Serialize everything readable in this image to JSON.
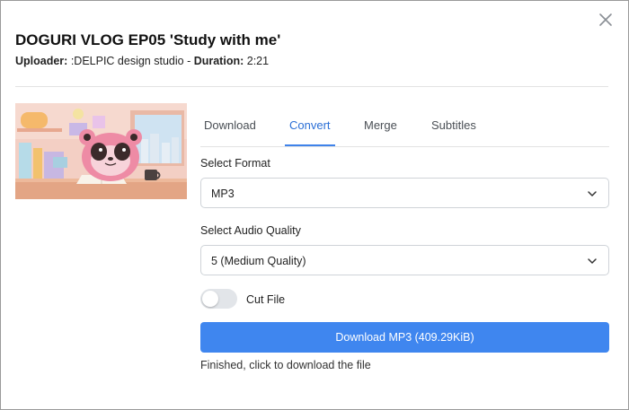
{
  "video": {
    "title": "DOGURI VLOG EP05 'Study with me'",
    "uploader_label": "Uploader:",
    "uploader": ":DELPIC design studio",
    "separator": " - ",
    "duration_label": "Duration:",
    "duration": "2:21"
  },
  "tabs": [
    {
      "label": "Download",
      "active": false
    },
    {
      "label": "Convert",
      "active": true
    },
    {
      "label": "Merge",
      "active": false
    },
    {
      "label": "Subtitles",
      "active": false
    }
  ],
  "format": {
    "label": "Select Format",
    "value": "MP3"
  },
  "quality": {
    "label": "Select Audio Quality",
    "value": "5 (Medium Quality)"
  },
  "cut_file": {
    "label": "Cut File",
    "enabled": false
  },
  "download_button": {
    "label": "Download MP3 (409.29KiB)"
  },
  "status": "Finished, click to download the file",
  "icons": {
    "close": "close-icon",
    "chevron": "chevron-down-icon"
  },
  "colors": {
    "accent": "#3f86ef",
    "active_tab": "#2b6fd6"
  }
}
